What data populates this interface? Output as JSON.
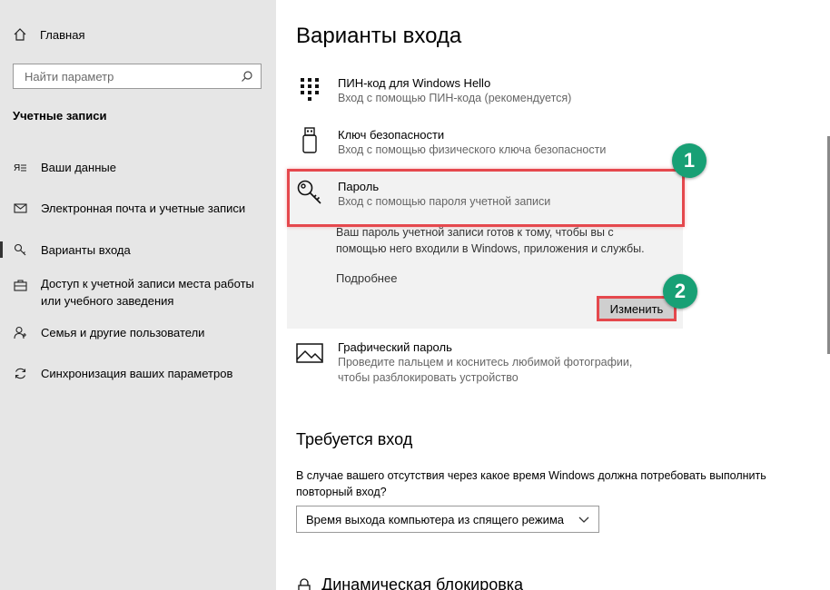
{
  "sidebar": {
    "home": "Главная",
    "search_placeholder": "Найти параметр",
    "section": "Учетные записи",
    "items": [
      {
        "label": "Ваши данные",
        "icon": "user-card-icon"
      },
      {
        "label": "Электронная почта и учетные записи",
        "icon": "mail-icon"
      },
      {
        "label": "Варианты входа",
        "icon": "key-icon"
      },
      {
        "label": "Доступ к учетной записи места работы",
        "label2": "или учебного заведения",
        "icon": "briefcase-icon"
      },
      {
        "label": "Семья и другие пользователи",
        "icon": "person-add-icon"
      },
      {
        "label": "Синхронизация ваших параметров",
        "icon": "sync-icon"
      }
    ]
  },
  "main": {
    "title": "Варианты входа",
    "options": [
      {
        "title": "ПИН-код для Windows Hello",
        "desc": "Вход с помощью ПИН-кода (рекомендуется)",
        "icon": "keypad-icon"
      },
      {
        "title": "Ключ безопасности",
        "desc": "Вход с помощью физического ключа безопасности",
        "icon": "usb-key-icon"
      },
      {
        "title": "Пароль",
        "desc": "Вход с помощью пароля учетной записи",
        "icon": "key-icon"
      },
      {
        "title": "Графический пароль",
        "desc": "Проведите пальцем и коснитесь любимой фотографии,",
        "desc2": "чтобы разблокировать устройство",
        "icon": "picture-icon"
      }
    ],
    "password_panel": {
      "text1": "Ваш пароль учетной записи готов к тому, чтобы вы с",
      "text2": "помощью него входили в Windows, приложения и службы.",
      "more": "Подробнее",
      "change_button": "Изменить"
    },
    "badges": [
      "1",
      "2"
    ],
    "require": {
      "heading": "Требуется вход",
      "text1": "В случае вашего отсутствия через какое время Windows должна потребовать выполнить",
      "text2": "повторный вход?",
      "dropdown": "Время выхода компьютера из спящего режима"
    },
    "dynamic_lock": "Динамическая блокировка"
  },
  "colors": {
    "sidebar_bg": "#e6e6e6",
    "highlight": "#e5484d",
    "badge": "#18a075"
  }
}
